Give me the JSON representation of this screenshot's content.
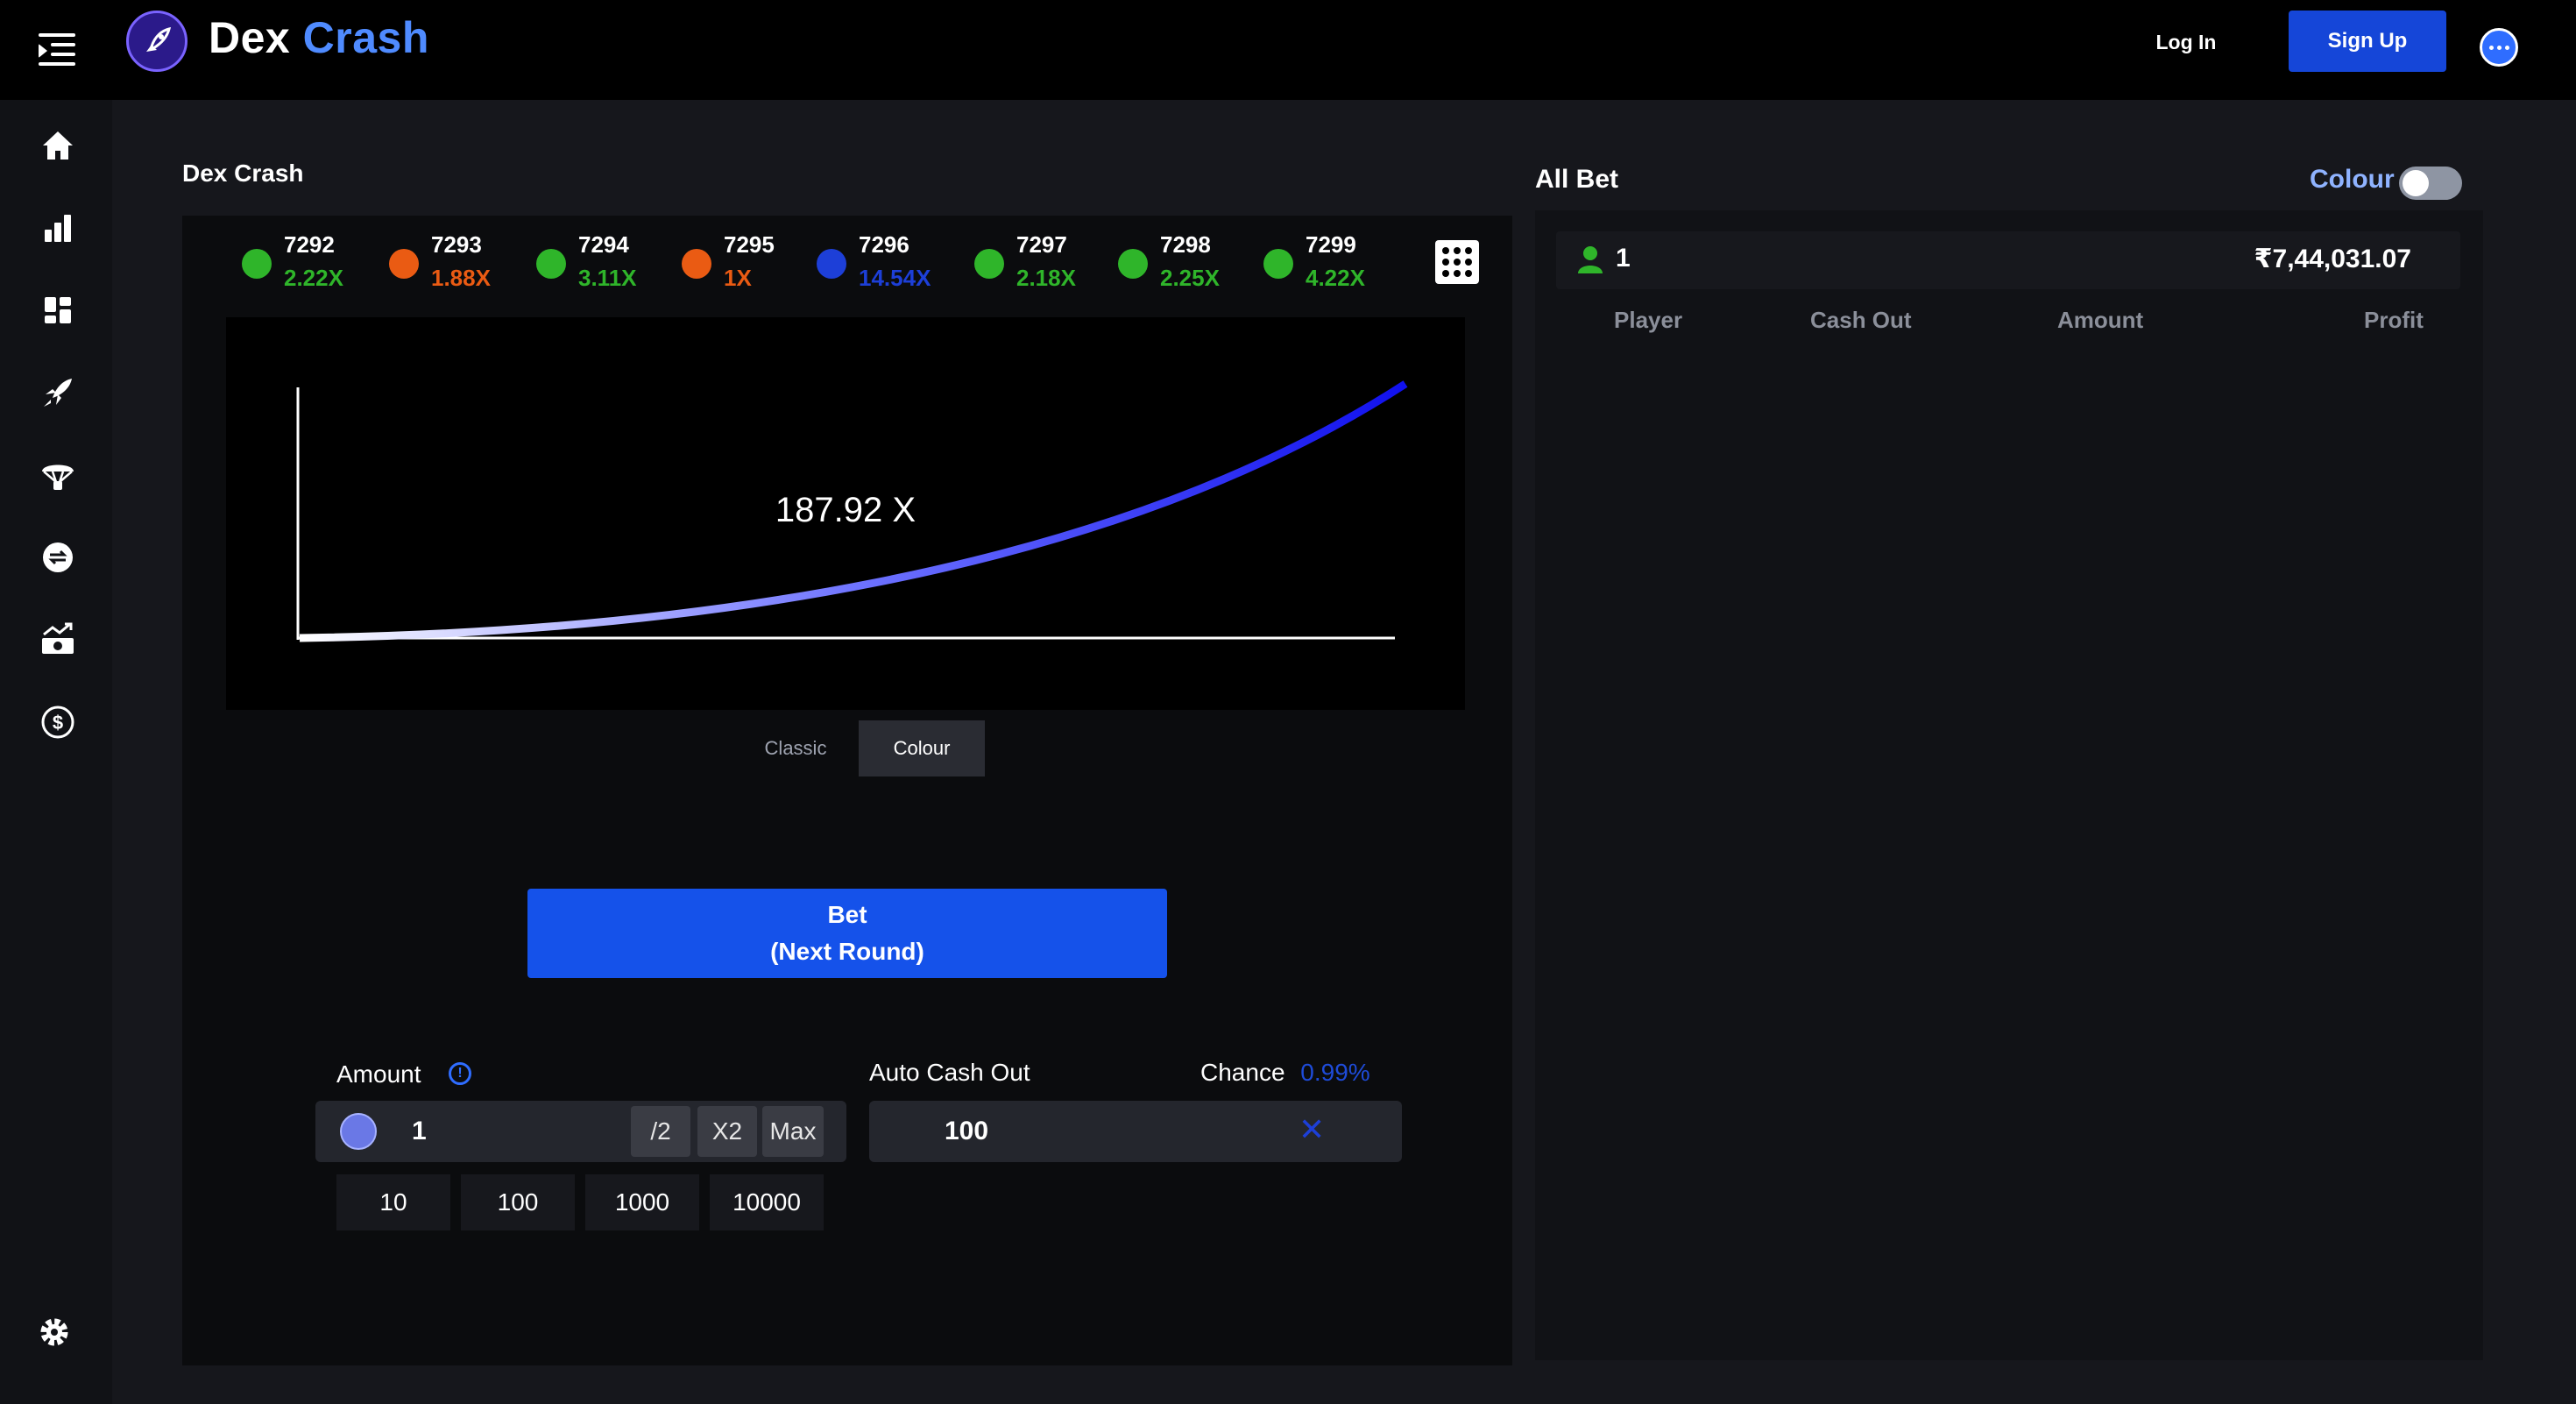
{
  "header": {
    "brand_part1": "Dex",
    "brand_part2": "Crash",
    "login_label": "Log In",
    "signup_label": "Sign Up",
    "icons": [
      "menu-icon",
      "rocket-logo",
      "chat-icon"
    ]
  },
  "sidebar": {
    "items": [
      {
        "name": "home",
        "icon": "home-icon"
      },
      {
        "name": "stats",
        "icon": "bar-chart-icon"
      },
      {
        "name": "dashboard",
        "icon": "grid-icon"
      },
      {
        "name": "crash",
        "icon": "rocket-icon"
      },
      {
        "name": "airdrop",
        "icon": "parachute-icon"
      },
      {
        "name": "swap",
        "icon": "swap-icon"
      },
      {
        "name": "earn",
        "icon": "money-icon"
      },
      {
        "name": "dollar",
        "icon": "dollar-icon"
      }
    ],
    "settings_icon": "gear-icon"
  },
  "game": {
    "title": "Dex Crash",
    "history": [
      {
        "id": "7292",
        "value": "2.22X",
        "color": "#2fb52a"
      },
      {
        "id": "7293",
        "value": "1.88X",
        "color": "#ea5b13"
      },
      {
        "id": "7294",
        "value": "3.11X",
        "color": "#2fb52a"
      },
      {
        "id": "7295",
        "value": "1X",
        "color": "#ea5b13"
      },
      {
        "id": "7296",
        "value": "14.54X",
        "color": "#1d3fd8"
      },
      {
        "id": "7297",
        "value": "2.18X",
        "color": "#2fb52a"
      },
      {
        "id": "7298",
        "value": "2.25X",
        "color": "#2fb52a"
      },
      {
        "id": "7299",
        "value": "4.22X",
        "color": "#2fb52a"
      }
    ],
    "multiplier": "187.92 X",
    "modes": [
      "Classic",
      "Colour"
    ],
    "active_mode": "Colour",
    "bet_line1": "Bet",
    "bet_line2": "(Next Round)",
    "amount_label": "Amount",
    "amount_value": "1",
    "half_label": "/2",
    "double_label": "X2",
    "max_label": "Max",
    "quick_amounts": [
      "10",
      "100",
      "1000",
      "10000"
    ],
    "auto_cashout_label": "Auto Cash Out",
    "auto_cashout_value": "100",
    "chance_label": "Chance",
    "chance_value": "0.99%"
  },
  "allbet": {
    "title": "All Bet",
    "colour_toggle_label": "Colour",
    "colour_toggle_on": false,
    "player_count": "1",
    "total": "₹7,44,031.07",
    "columns": [
      "Player",
      "Cash Out",
      "Amount",
      "Profit"
    ]
  },
  "colors": {
    "accent": "#1552ea",
    "win": "#2fb52a",
    "loss": "#ea5b13",
    "high": "#1d3fd8"
  }
}
